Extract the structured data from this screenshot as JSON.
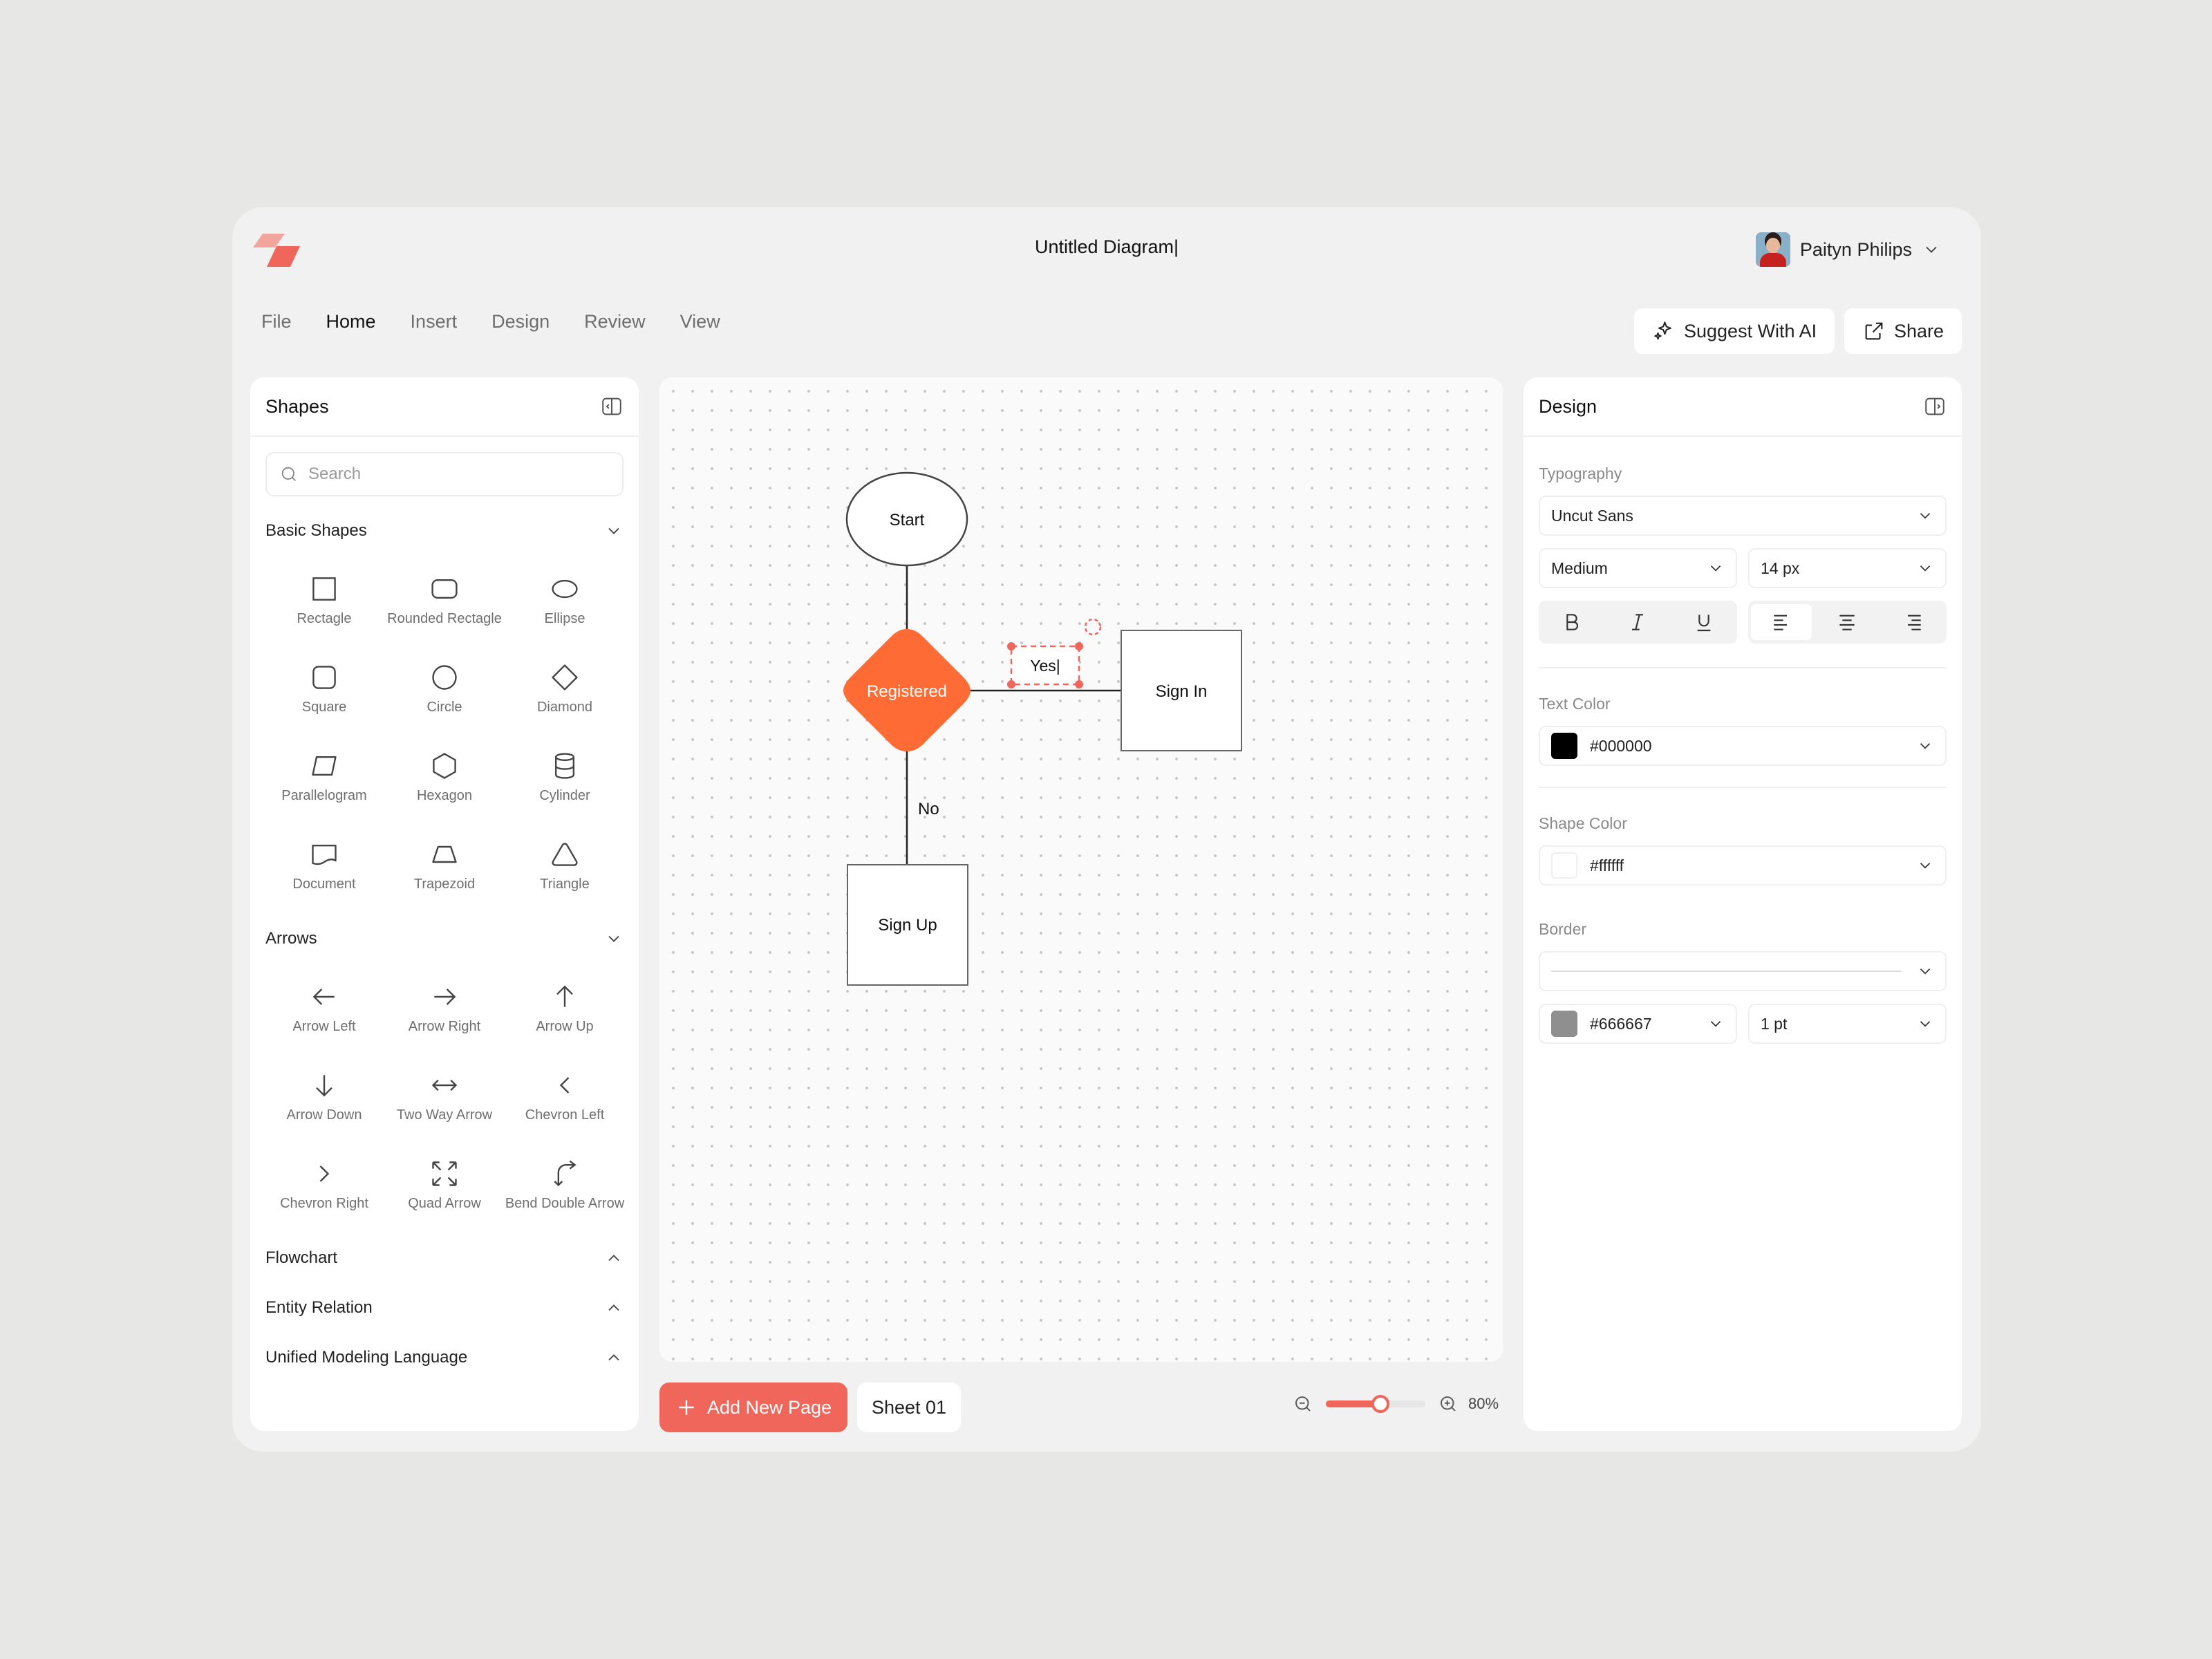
{
  "header": {
    "title": "Untitled Diagram|",
    "user_name": "Paityn Philips"
  },
  "menu": [
    "File",
    "Home",
    "Insert",
    "Design",
    "Review",
    "View"
  ],
  "menu_active": "Home",
  "actions": {
    "suggest_label": "Suggest With AI",
    "share_label": "Share"
  },
  "shapes_panel": {
    "title": "Shapes",
    "search_placeholder": "Search",
    "basic_title": "Basic Shapes",
    "basic": [
      {
        "label": "Rectagle",
        "icon": "rectangle-icon"
      },
      {
        "label": "Rounded Rectagle",
        "icon": "rounded-rectangle-icon"
      },
      {
        "label": "Ellipse",
        "icon": "ellipse-icon"
      },
      {
        "label": "Square",
        "icon": "square-icon"
      },
      {
        "label": "Circle",
        "icon": "circle-icon"
      },
      {
        "label": "Diamond",
        "icon": "diamond-icon"
      },
      {
        "label": "Parallelogram",
        "icon": "parallelogram-icon"
      },
      {
        "label": "Hexagon",
        "icon": "hexagon-icon"
      },
      {
        "label": "Cylinder",
        "icon": "cylinder-icon"
      },
      {
        "label": "Document",
        "icon": "document-icon"
      },
      {
        "label": "Trapezoid",
        "icon": "trapezoid-icon"
      },
      {
        "label": "Triangle",
        "icon": "triangle-icon"
      }
    ],
    "arrows_title": "Arrows",
    "arrows": [
      {
        "label": "Arrow Left",
        "icon": "arrow-left-icon"
      },
      {
        "label": "Arrow Right",
        "icon": "arrow-right-icon"
      },
      {
        "label": "Arrow Up",
        "icon": "arrow-up-icon"
      },
      {
        "label": "Arrow Down",
        "icon": "arrow-down-icon"
      },
      {
        "label": "Two Way Arrow",
        "icon": "two-way-arrow-icon"
      },
      {
        "label": "Chevron Left",
        "icon": "chevron-left-icon"
      },
      {
        "label": "Chevron Right",
        "icon": "chevron-right-icon"
      },
      {
        "label": "Quad Arrow",
        "icon": "quad-arrow-icon"
      },
      {
        "label": "Bend Double Arrow",
        "icon": "bend-double-arrow-icon"
      }
    ],
    "collapsed_sections": [
      "Flowchart",
      "Entity Relation",
      "Unified Modeling Language"
    ]
  },
  "diagram": {
    "start": "Start",
    "decision": "Registered",
    "sign_in": "Sign In",
    "sign_up": "Sign Up",
    "yes_label": "Yes|",
    "no_label": "No"
  },
  "bottom": {
    "add_page_label": "Add New Page",
    "sheet_label": "Sheet 01",
    "zoom_label": "80%",
    "zoom_fraction": 0.55
  },
  "design_panel": {
    "title": "Design",
    "typography_label": "Typography",
    "font_family": "Uncut Sans",
    "font_weight": "Medium",
    "font_size": "14 px",
    "text_color_label": "Text Color",
    "text_color": "#000000",
    "shape_color_label": "Shape Color",
    "shape_color": "#ffffff",
    "border_label": "Border",
    "border_color": "#666667",
    "border_width": "1 pt"
  },
  "colors": {
    "accent": "#f0665a",
    "decision_fill": "#ff6b35"
  }
}
